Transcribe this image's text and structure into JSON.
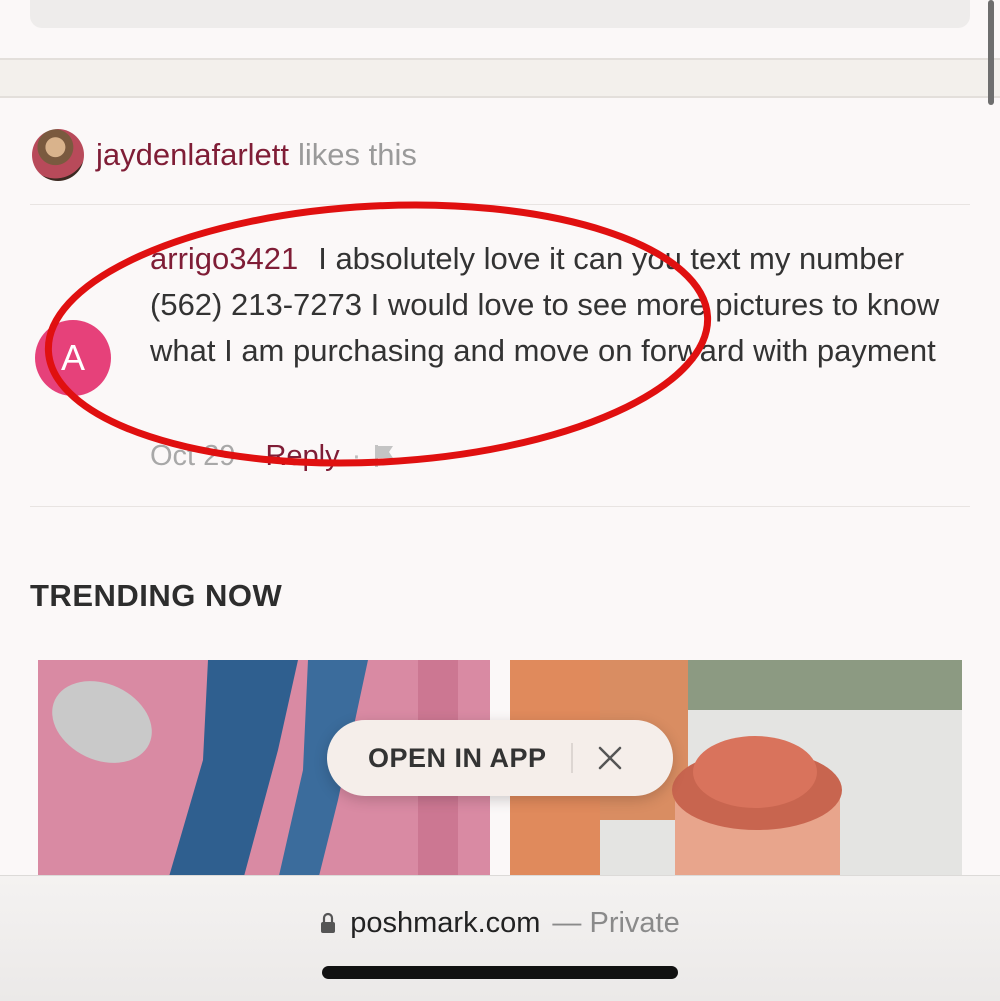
{
  "likes": {
    "username": "jaydenlafarlett",
    "text": "likes this"
  },
  "comment": {
    "avatar_letter": "A",
    "username": "arrigo3421",
    "body": "I absolutely love it can you text my number (562) 213-7273 I would love to see more pictures to know what I am purchasing and move on forward with payment",
    "date": "Oct 29",
    "reply_label": "Reply",
    "separator": "·"
  },
  "trending": {
    "title": "TRENDING NOW"
  },
  "open_in_app": {
    "label": "OPEN IN APP"
  },
  "browser": {
    "domain": "poshmark.com",
    "mode": "— Private"
  },
  "colors": {
    "brand": "#7f1d36",
    "avatar_pink": "#e6417a",
    "annotation_red": "#e01010"
  },
  "icons": [
    "lock-icon",
    "close-icon",
    "flag-icon"
  ]
}
